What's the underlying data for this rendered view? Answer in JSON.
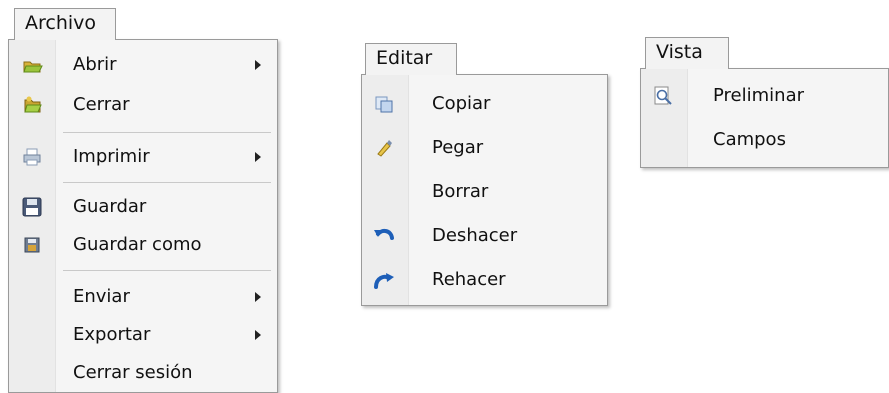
{
  "archivo": {
    "tab_label": "Archivo",
    "items": [
      {
        "label": "Abrir",
        "icon": "open-folder-icon",
        "submenu": true
      },
      {
        "label": "Cerrar",
        "icon": "close-file-icon",
        "submenu": false
      },
      {
        "label": "Imprimir",
        "icon": "printer-icon",
        "submenu": true
      },
      {
        "label": "Guardar",
        "icon": "floppy-disk-icon",
        "submenu": false
      },
      {
        "label": "Guardar como",
        "icon": "save-as-icon",
        "submenu": false
      },
      {
        "label": "Enviar",
        "icon": "",
        "submenu": true
      },
      {
        "label": "Exportar",
        "icon": "",
        "submenu": true
      },
      {
        "label": "Cerrar sesión",
        "icon": "",
        "submenu": false
      }
    ]
  },
  "editar": {
    "tab_label": "Editar",
    "items": [
      {
        "label": "Copiar",
        "icon": "copy-icon"
      },
      {
        "label": "Pegar",
        "icon": "paste-icon"
      },
      {
        "label": "Borrar",
        "icon": ""
      },
      {
        "label": "Deshacer",
        "icon": "undo-icon"
      },
      {
        "label": "Rehacer",
        "icon": "redo-icon"
      }
    ]
  },
  "vista": {
    "tab_label": "Vista",
    "items": [
      {
        "label": "Preliminar",
        "icon": "magnifier-icon"
      },
      {
        "label": "Campos",
        "icon": ""
      }
    ]
  },
  "colors": {
    "menu_bg": "#f5f5f5",
    "gutter_bg": "#ededed",
    "border": "#9a9a9a",
    "undo_redo_blue": "#1e5fb8"
  }
}
